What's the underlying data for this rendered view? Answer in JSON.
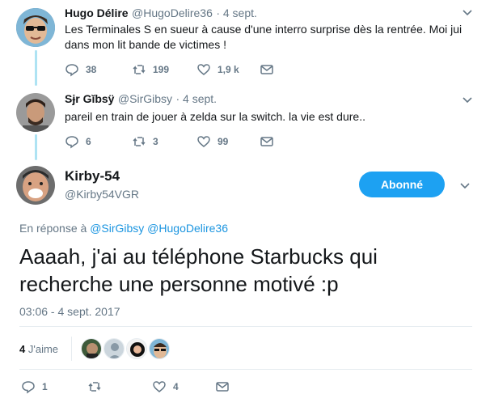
{
  "tweets": [
    {
      "name": "Hugo Délire",
      "handle": "@HugoDelire36",
      "date": "· 4 sept.",
      "text": "Les Terminales S en sueur à cause d'une interro surprise dès la rentrée. Moi jui dans mon lit bande de victimes !",
      "replies": "38",
      "retweets": "199",
      "likes": "1,9 k"
    },
    {
      "name": "Sɉr Gĭbsÿ",
      "handle": "@SirGibsy",
      "date": "· 4 sept.",
      "text": "pareil en train de jouer à zelda sur la switch. la vie est dure..",
      "replies": "6",
      "retweets": "3",
      "likes": "99"
    }
  ],
  "main": {
    "name": "Kirby-54",
    "handle": "@Kirby54VGR",
    "follow_label": "Abonné",
    "reply_prefix": "En réponse à",
    "reply_users": "@SirGibsy @HugoDelire36",
    "text": "Aaaah, j'ai au téléphone Starbucks qui recherche une personne motivé :p",
    "timestamp": "03:06 - 4 sept. 2017",
    "likes_count": "4",
    "likes_word": "J'aime",
    "action_replies": "1",
    "action_likes": "4"
  },
  "colors": {
    "accent": "#1da1f2",
    "link": "#1b95e0",
    "muted": "#657786",
    "thread": "#aee3f3"
  },
  "icons": [
    "reply-icon",
    "retweet-icon",
    "like-icon",
    "message-icon",
    "chevron-down-icon"
  ]
}
